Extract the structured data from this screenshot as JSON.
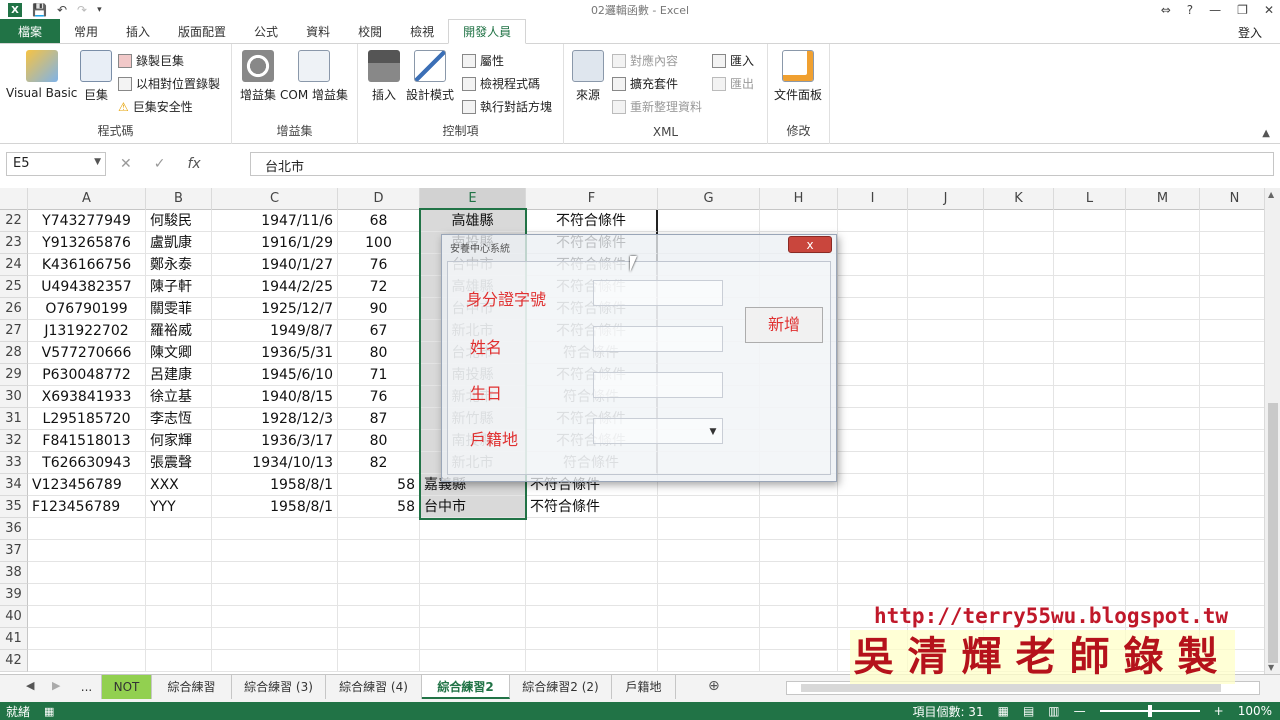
{
  "window": {
    "title": "02邏輯函數 - Excel",
    "sign_in": "登入"
  },
  "tabs": [
    "檔案",
    "常用",
    "插入",
    "版面配置",
    "公式",
    "資料",
    "校閱",
    "檢視",
    "開發人員"
  ],
  "active_tab": "開發人員",
  "ribbon": {
    "groups": [
      {
        "label": "程式碼",
        "big": [
          "Visual Basic",
          "巨集"
        ],
        "small": [
          "錄製巨集",
          "以相對位置錄製",
          "巨集安全性"
        ]
      },
      {
        "label": "增益集",
        "big": [
          "增益集",
          "COM 增益集"
        ]
      },
      {
        "label": "控制項",
        "big": [
          "插入",
          "設計模式"
        ],
        "small": [
          "屬性",
          "檢視程式碼",
          "執行對話方塊"
        ]
      },
      {
        "label": "XML",
        "big": [
          "來源"
        ],
        "small": [
          "對應內容",
          "擴充套件",
          "重新整理資料",
          "匯入",
          "匯出"
        ]
      },
      {
        "label": "修改",
        "big": [
          "文件面板"
        ]
      }
    ]
  },
  "formula_bar": {
    "name_box": "E5",
    "content": "台北市"
  },
  "columns": [
    "A",
    "B",
    "C",
    "D",
    "E",
    "F",
    "G",
    "H",
    "I",
    "J",
    "K",
    "L",
    "M",
    "N"
  ],
  "rows": [
    {
      "n": "22",
      "a": "Y743277949",
      "b": "何駿民",
      "c": "1947/11/6",
      "d": "68",
      "e": "高雄縣",
      "f": "不符合條件"
    },
    {
      "n": "23",
      "a": "Y913265876",
      "b": "盧凱康",
      "c": "1916/1/29",
      "d": "100",
      "e": "南投縣",
      "f": "不符合條件"
    },
    {
      "n": "24",
      "a": "K436166756",
      "b": "鄭永泰",
      "c": "1940/1/27",
      "d": "76",
      "e": "台中市",
      "f": "不符合條件"
    },
    {
      "n": "25",
      "a": "U494382357",
      "b": "陳子軒",
      "c": "1944/2/25",
      "d": "72",
      "e": "高雄縣",
      "f": "不符合條件"
    },
    {
      "n": "26",
      "a": "O76790199",
      "b": "關雯菲",
      "c": "1925/12/7",
      "d": "90",
      "e": "台中市",
      "f": "不符合條件"
    },
    {
      "n": "27",
      "a": "J131922702",
      "b": "羅裕威",
      "c": "1949/8/7",
      "d": "67",
      "e": "新北市",
      "f": "不符合條件"
    },
    {
      "n": "28",
      "a": "V577270666",
      "b": "陳文卿",
      "c": "1936/5/31",
      "d": "80",
      "e": "台北市",
      "f": "符合條件"
    },
    {
      "n": "29",
      "a": "P630048772",
      "b": "呂建康",
      "c": "1945/6/10",
      "d": "71",
      "e": "南投縣",
      "f": "不符合條件"
    },
    {
      "n": "30",
      "a": "X693841933",
      "b": "徐立基",
      "c": "1940/8/15",
      "d": "76",
      "e": "新北市",
      "f": "符合條件"
    },
    {
      "n": "31",
      "a": "L295185720",
      "b": "李志恆",
      "c": "1928/12/3",
      "d": "87",
      "e": "新竹縣",
      "f": "不符合條件"
    },
    {
      "n": "32",
      "a": "F841518013",
      "b": "何家輝",
      "c": "1936/3/17",
      "d": "80",
      "e": "南投縣",
      "f": "不符合條件"
    },
    {
      "n": "33",
      "a": "T626630943",
      "b": "張震聲",
      "c": "1934/10/13",
      "d": "82",
      "e": "新北市",
      "f": "符合條件"
    },
    {
      "n": "34",
      "a": "V123456789",
      "b": "XXX",
      "c": "1958/8/1",
      "d": "58",
      "e": "嘉義縣",
      "f": "不符合條件"
    },
    {
      "n": "35",
      "a": "F123456789",
      "b": "YYY",
      "c": "1958/8/1",
      "d": "58",
      "e": "台中市",
      "f": "不符合條件"
    },
    {
      "n": "36"
    },
    {
      "n": "37"
    },
    {
      "n": "38"
    },
    {
      "n": "39"
    },
    {
      "n": "40"
    },
    {
      "n": "41"
    },
    {
      "n": "42"
    }
  ],
  "dialog": {
    "title": "安養中心系統",
    "close": "x",
    "labels": [
      "身分證字號",
      "姓名",
      "生日",
      "戶籍地"
    ],
    "button": "新增"
  },
  "sheets": [
    "...",
    "NOT",
    "綜合練習",
    "綜合練習 (3)",
    "綜合練習 (4)",
    "綜合練習2",
    "綜合練習2 (2)",
    "戶籍地"
  ],
  "active_sheet": "綜合練習2",
  "status": {
    "left": "就緒",
    "count": "項目個數: 31",
    "zoom": "100%"
  },
  "watermark": {
    "url": "http://terry55wu.blogspot.tw",
    "name": "吳清輝老師錄製"
  },
  "colors": {
    "excel_green": "#217346",
    "not_tab": "#92d050",
    "dialog_label": "#e03030"
  }
}
